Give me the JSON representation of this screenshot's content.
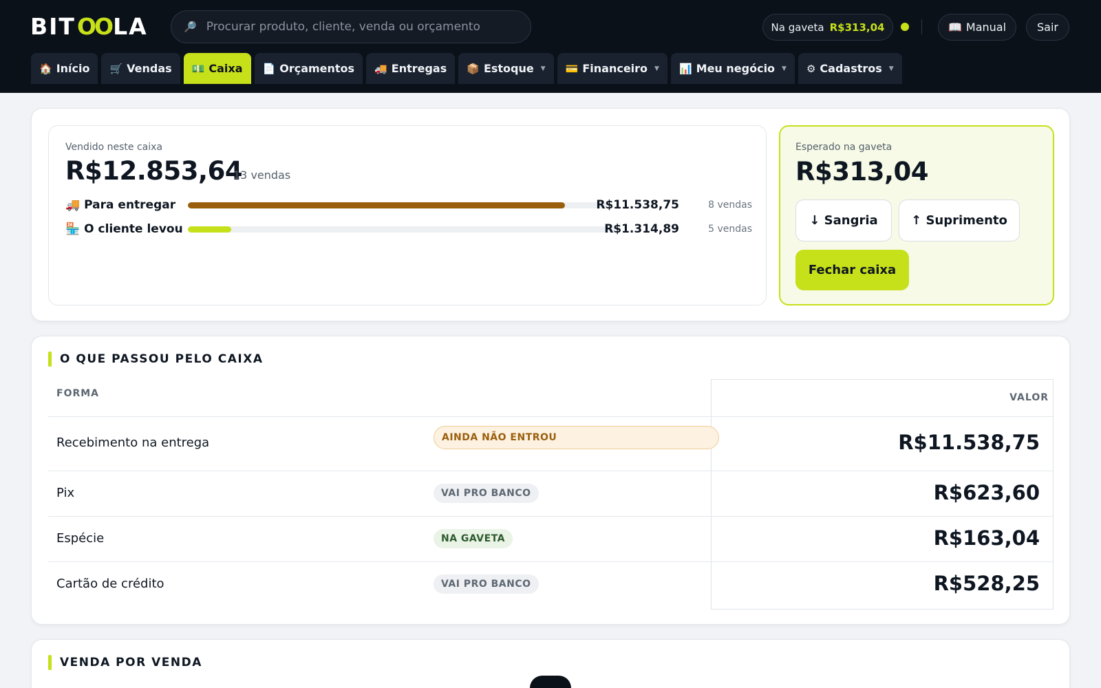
{
  "brand": {
    "logo_left": "BIT",
    "logo_mid": "OO",
    "logo_right": "LA"
  },
  "search": {
    "placeholder": "Procurar produto, cliente, venda ou orçamento"
  },
  "header": {
    "drawer_label": "Na gaveta",
    "drawer_amount": "R$313,04",
    "manual_label": "Manual",
    "exit_label": "Sair"
  },
  "nav": [
    {
      "icon": "🏠",
      "label": "Início"
    },
    {
      "icon": "🛒",
      "label": "Vendas"
    },
    {
      "icon": "💵",
      "label": "Caixa",
      "active": true
    },
    {
      "icon": "📄",
      "label": "Orçamentos"
    },
    {
      "icon": "🚚",
      "label": "Entregas"
    },
    {
      "icon": "📦",
      "label": "Estoque",
      "dropdown": true
    },
    {
      "icon": "💳",
      "label": "Financeiro",
      "dropdown": true
    },
    {
      "icon": "📊",
      "label": "Meu negócio",
      "dropdown": true
    },
    {
      "icon": "⚙",
      "label": "Cadastros",
      "dropdown": true
    }
  ],
  "summary": {
    "sold_label": "Vendido neste caixa",
    "sold_amount": "R$12.853,64",
    "sold_count": "13 vendas",
    "rows": [
      {
        "icon": "🚚",
        "label": "Para entregar",
        "value": "R$11.538,75",
        "count": "8 vendas",
        "fraction": 0.898,
        "color": "#9a5f0d"
      },
      {
        "icon": "🏪",
        "label": "O cliente levou",
        "value": "R$1.314,89",
        "count": "5 vendas",
        "fraction": 0.102,
        "color": "#c6e01a"
      }
    ]
  },
  "drawer": {
    "label": "Esperado na gaveta",
    "amount": "R$313,04",
    "sangria": "↓ Sangria",
    "suprimento": "↑ Suprimento",
    "close": "Fechar caixa"
  },
  "payments": {
    "title": "O QUE PASSOU PELO CAIXA",
    "col_forma": "FORMA",
    "col_valor": "VALOR",
    "rows": [
      {
        "forma": "Recebimento na entrega",
        "badge": "AINDA NÃO ENTROU",
        "kind": "pend",
        "valor": "R$11.538,75"
      },
      {
        "forma": "Pix",
        "badge": "VAI PRO BANCO",
        "kind": "bank",
        "valor": "R$623,60"
      },
      {
        "forma": "Espécie",
        "badge": "NA GAVETA",
        "kind": "gav",
        "valor": "R$163,04"
      },
      {
        "forma": "Cartão de crédito",
        "badge": "VAI PRO BANCO",
        "kind": "bank",
        "valor": "R$528,25"
      }
    ]
  },
  "sales": {
    "title": "VENDA POR VENDA"
  }
}
